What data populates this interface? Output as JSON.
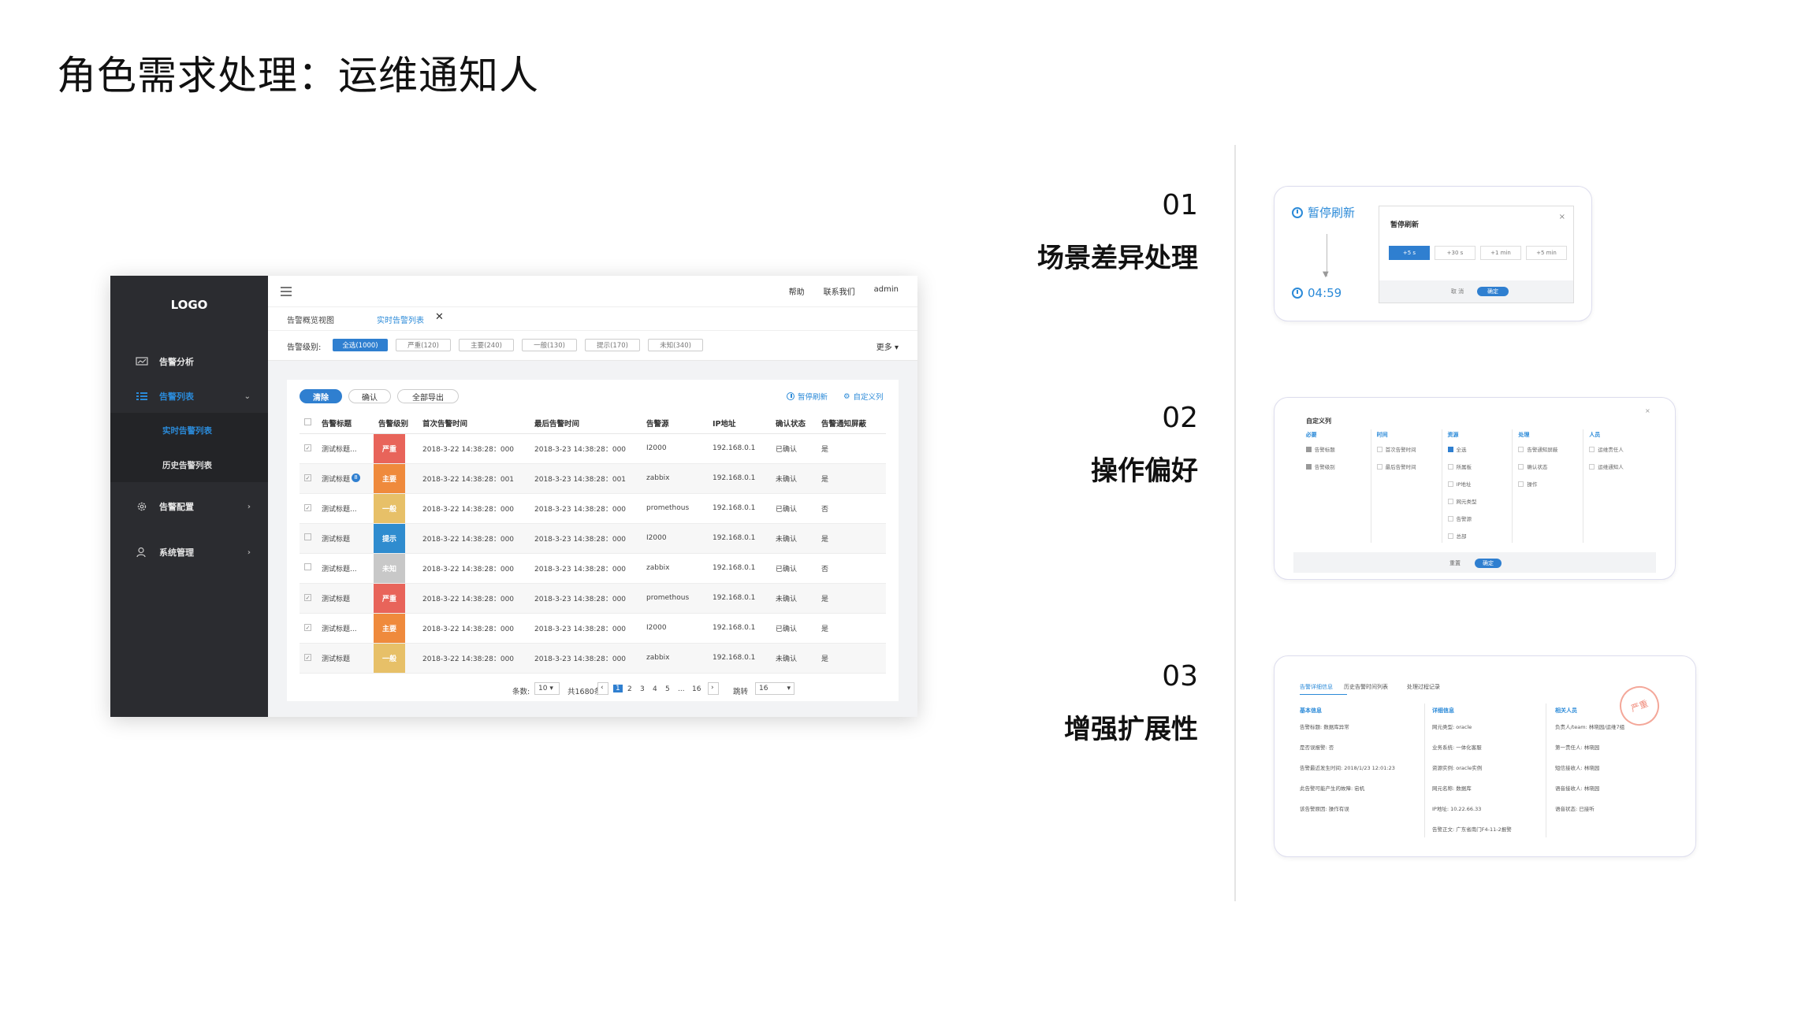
{
  "page_title": "角色需求处理：运维通知人",
  "mock": {
    "logo": "LOGO",
    "nav": [
      {
        "label": "告警分析",
        "arrow": ""
      },
      {
        "label": "告警列表",
        "arrow": "⌄"
      },
      {
        "label": "告警配置",
        "arrow": "›"
      },
      {
        "label": "系统管理",
        "arrow": "›"
      }
    ],
    "nav_sub": [
      "实时告警列表",
      "历史告警列表"
    ],
    "top_links": [
      "帮助",
      "联系我们",
      "admin"
    ],
    "tabs": [
      "告警概览视图",
      "实时告警列表"
    ],
    "tab_close": "✕",
    "level_label": "告警级别:",
    "level_chips": [
      "全选(1000)",
      "严重(120)",
      "主要(240)",
      "一般(130)",
      "提示(170)",
      "未知(340)"
    ],
    "more": "更多 ▾",
    "buttons": [
      "清除",
      "确认",
      "全部导出"
    ],
    "pause_refresh": "暂停刷新",
    "custom_columns": "自定义列",
    "columns": [
      "",
      "告警标题",
      "告警级别",
      "首次告警时间",
      "最后告警时间",
      "告警源",
      "IP地址",
      "确认状态",
      "告警通知屏蔽"
    ],
    "rows": [
      {
        "check": "✓",
        "title": "测试标题...",
        "badge": "",
        "level": "严重",
        "color": "#e8645a",
        "first": "2018-3-22 14:38:28：000",
        "last": "2018-3-23 14:38:28：000",
        "source": "I2000",
        "ip": "192.168.0.1",
        "confirm": "已确认",
        "mute": "是"
      },
      {
        "check": "✓",
        "title": "测试标题",
        "badge": "8",
        "level": "主要",
        "color": "#ef8a3c",
        "first": "2018-3-22 14:38:28：001",
        "last": "2018-3-23 14:38:28：001",
        "source": "zabbix",
        "ip": "192.168.0.1",
        "confirm": "未确认",
        "mute": "是"
      },
      {
        "check": "✓",
        "title": "测试标题...",
        "badge": "",
        "level": "一般",
        "color": "#e7c068",
        "first": "2018-3-22 14:38:28：000",
        "last": "2018-3-23 14:38:28：000",
        "source": "promethous",
        "ip": "192.168.0.1",
        "confirm": "已确认",
        "mute": "否"
      },
      {
        "check": "",
        "title": "测试标题",
        "badge": "",
        "level": "提示",
        "color": "#2f8ccf",
        "first": "2018-3-22 14:38:28：000",
        "last": "2018-3-23 14:38:28：000",
        "source": "I2000",
        "ip": "192.168.0.1",
        "confirm": "未确认",
        "mute": "是"
      },
      {
        "check": "",
        "title": "测试标题...",
        "badge": "",
        "level": "未知",
        "color": "#c8c8c8",
        "first": "2018-3-22 14:38:28：000",
        "last": "2018-3-23 14:38:28：000",
        "source": "zabbix",
        "ip": "192.168.0.1",
        "confirm": "已确认",
        "mute": "否"
      },
      {
        "check": "✓",
        "title": "测试标题",
        "badge": "",
        "level": "严重",
        "color": "#e8645a",
        "first": "2018-3-22 14:38:28：000",
        "last": "2018-3-23 14:38:28：000",
        "source": "promethous",
        "ip": "192.168.0.1",
        "confirm": "未确认",
        "mute": "是"
      },
      {
        "check": "✓",
        "title": "测试标题...",
        "badge": "",
        "level": "主要",
        "color": "#ef8a3c",
        "first": "2018-3-22 14:38:28：000",
        "last": "2018-3-23 14:38:28：000",
        "source": "I2000",
        "ip": "192.168.0.1",
        "confirm": "已确认",
        "mute": "是"
      },
      {
        "check": "✓",
        "title": "测试标题",
        "badge": "",
        "level": "一般",
        "color": "#e7c068",
        "first": "2018-3-22 14:38:28：000",
        "last": "2018-3-23 14:38:28：000",
        "source": "zabbix",
        "ip": "192.168.0.1",
        "confirm": "未确认",
        "mute": "是"
      }
    ],
    "pager": {
      "size_label": "条数:",
      "size": "10",
      "total": "共1680条",
      "prev": "‹",
      "pages": [
        "1",
        "2",
        "3",
        "4",
        "5",
        "...",
        "16"
      ],
      "next": "›",
      "jump_label": "跳转",
      "jump": "16"
    }
  },
  "sections": [
    {
      "num": "01",
      "title": "场景差异处理"
    },
    {
      "num": "02",
      "title": "操作偏好"
    },
    {
      "num": "03",
      "title": "增强扩展性"
    }
  ],
  "card1": {
    "link": "暂停刷新",
    "timer": "04:59",
    "dialog_title": "暂停刷新",
    "close": "×",
    "options": [
      "+5 s",
      "+30 s",
      "+1 min",
      "+5 min"
    ],
    "cancel": "取 消",
    "ok": "确定"
  },
  "card2": {
    "title": "自定义列",
    "close": "×",
    "columns": [
      {
        "head": "必要",
        "items": [
          "告警标题",
          "告警级别"
        ]
      },
      {
        "head": "时间",
        "items": [
          "首次告警时间",
          "最后告警时间"
        ]
      },
      {
        "head": "资源",
        "items": [
          "全选",
          "所属板",
          "IP地址",
          "网元类型",
          "告警源",
          "总部"
        ]
      },
      {
        "head": "处理",
        "items": [
          "告警通知屏蔽",
          "确认状态",
          "操作"
        ]
      },
      {
        "head": "人员",
        "items": [
          "运维责任人",
          "运维通知人"
        ]
      }
    ],
    "reset": "重置",
    "ok": "确定"
  },
  "card3": {
    "tabs": [
      "告警详细信息",
      "历史告警时间列表",
      "处理过程记录"
    ],
    "basic_head": "基本信息",
    "basic": [
      "告警标题:  数据库异常",
      "是否误报警:  否",
      "告警最近发生时间:  2018/1/23 12:01:23",
      "此告警可能产生的故障:  宕机",
      "该告警原因:  操作有误"
    ],
    "detail_head": "详细信息",
    "detail": [
      "网元类型:  oracle",
      "业务系统:  一体化客服",
      "资源实例:  oracle实例",
      "网元名称:  数据库",
      "IP地址:  10.22.66.33",
      "告警正文:  广东省南门F4-11-2报警"
    ],
    "people_head": "相关人员",
    "people": [
      "负责人/team:  林晓园/运维7组",
      "第一责任人:  林晓园",
      "短信接收人:  林晓园",
      "语音接收人:  林晓园",
      "语音状态:  已接听"
    ],
    "stamp": "严重"
  }
}
